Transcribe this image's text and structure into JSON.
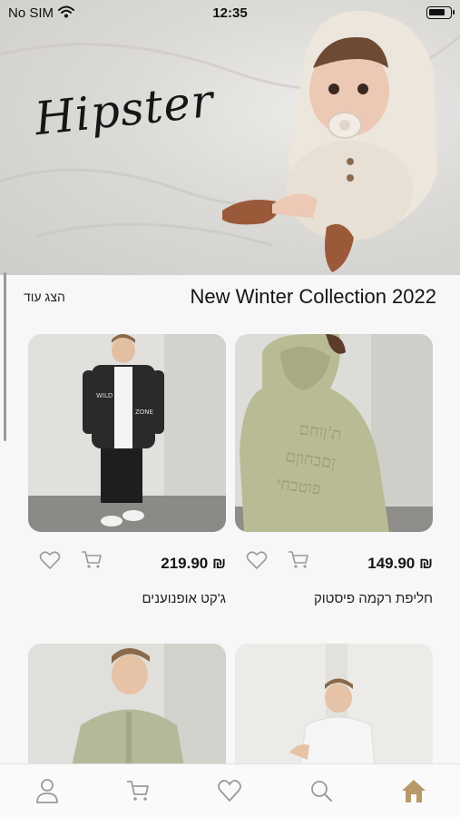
{
  "status_bar": {
    "carrier": "No SIM",
    "time": "12:35"
  },
  "hero": {
    "logo_text": "Hipster",
    "icon": "hero-photo"
  },
  "section": {
    "title": "New Winter Collection 2022",
    "show_more": "הצג עוד"
  },
  "products": [
    {
      "name": "חליפת רקמה פיסטוק",
      "price": "₪ 149.90",
      "image_icon": "pistachio-embroidered-suit-photo"
    },
    {
      "name": "ג'קט אופנוענים",
      "price": "₪ 219.90",
      "image_icon": "biker-jacket-photo"
    },
    {
      "name": "",
      "price": "",
      "image_icon": "white-shirt-photo"
    },
    {
      "name": "",
      "price": "",
      "image_icon": "green-cardigan-photo"
    }
  ],
  "bottom_nav": {
    "items": [
      "home-icon",
      "search-icon",
      "heart-icon",
      "cart-icon",
      "profile-icon"
    ],
    "active": "home-icon"
  },
  "colors": {
    "accent_active_nav": "#b89a6a",
    "nav_icon": "#9a9a9a",
    "background": "#f7f7f7"
  }
}
